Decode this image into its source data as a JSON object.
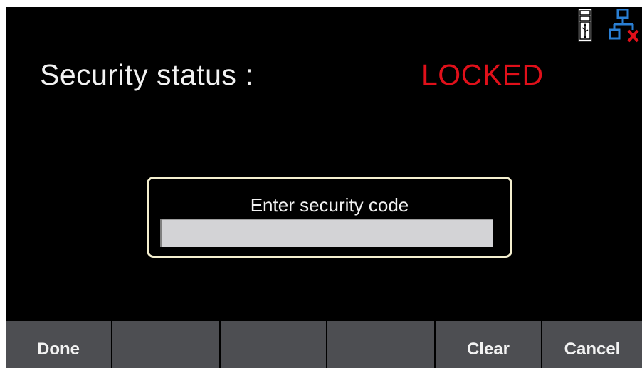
{
  "status_bar": {
    "icons": [
      "usb-storage-icon",
      "lan-disconnected-icon"
    ]
  },
  "security": {
    "label": "Security status :",
    "status": "LOCKED",
    "status_color": "#e0101a"
  },
  "code_dialog": {
    "title": "Enter security code",
    "input_value": "",
    "border_color": "#f4efcf"
  },
  "softkeys": [
    {
      "label": "Done"
    },
    {
      "label": ""
    },
    {
      "label": ""
    },
    {
      "label": ""
    },
    {
      "label": "Clear"
    },
    {
      "label": "Cancel"
    }
  ],
  "colors": {
    "screen_background": "#000000",
    "softkey_background": "#4d4e52",
    "input_background": "#d3d3d6"
  }
}
